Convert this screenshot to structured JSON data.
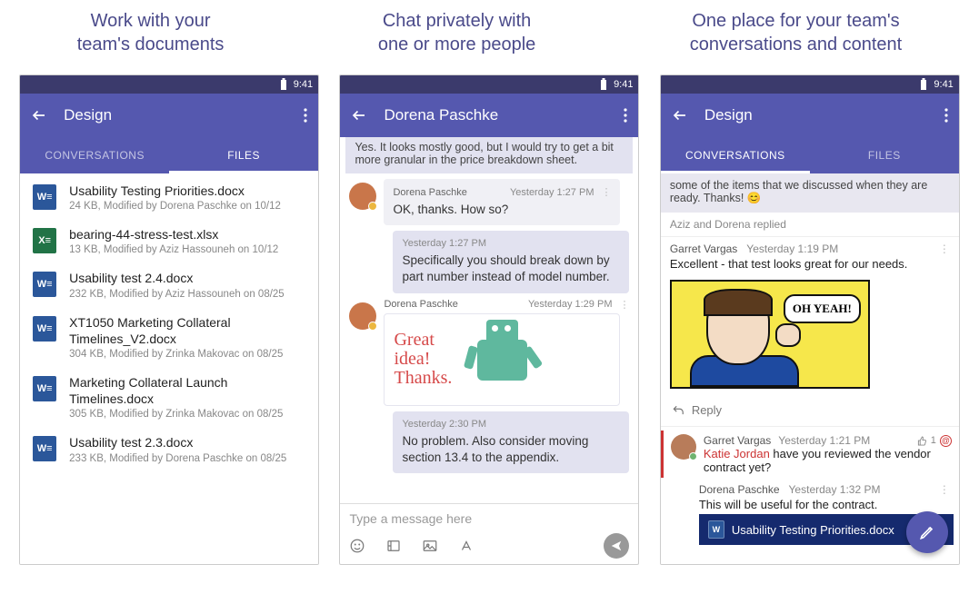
{
  "captions": [
    "Work with your\nteam's documents",
    "Chat privately with\none or more people",
    "One place for your team's\nconversations and content"
  ],
  "status": {
    "time": "9:41"
  },
  "panel1": {
    "title": "Design",
    "tabs": {
      "conversations": "CONVERSATIONS",
      "files": "FILES"
    },
    "files": [
      {
        "type": "word",
        "name": "Usability Testing Priorities.docx",
        "meta": "24 KB, Modified by Dorena Paschke on 10/12"
      },
      {
        "type": "excel",
        "name": "bearing-44-stress-test.xlsx",
        "meta": "13 KB, Modified by Aziz Hassouneh on 10/12"
      },
      {
        "type": "word",
        "name": "Usability test 2.4.docx",
        "meta": "232 KB, Modified by Aziz Hassouneh on 08/25"
      },
      {
        "type": "word",
        "name": "XT1050 Marketing Collateral Timelines_V2.docx",
        "meta": "304 KB, Modified by Zrinka Makovac on 08/25"
      },
      {
        "type": "word",
        "name": "Marketing Collateral Launch Timelines.docx",
        "meta": "305 KB, Modified by Zrinka Makovac on 08/25"
      },
      {
        "type": "word",
        "name": "Usability test 2.3.docx",
        "meta": "233 KB, Modified by Dorena Paschke on 08/25"
      }
    ]
  },
  "panel2": {
    "title": "Dorena Paschke",
    "cut_msg": "Yes. It looks mostly good, but I would try to get a bit more granular in the price breakdown sheet.",
    "messages": [
      {
        "side": "in",
        "name": "Dorena Paschke",
        "time": "Yesterday 1:27 PM",
        "text": "OK, thanks. How so?"
      },
      {
        "side": "out",
        "time": "Yesterday 1:27 PM",
        "text": "Specifically you should break down by part number instead of model number."
      },
      {
        "side": "in",
        "name": "Dorena Paschke",
        "time": "Yesterday 1:29 PM",
        "sticker": "Great idea! Thanks."
      },
      {
        "side": "out",
        "time": "Yesterday 2:30 PM",
        "text": "No problem. Also consider moving section 13.4 to the appendix."
      }
    ],
    "compose": {
      "placeholder": "Type a message here"
    }
  },
  "panel3": {
    "title": "Design",
    "tabs": {
      "conversations": "CONVERSATIONS",
      "files": "FILES"
    },
    "trail": "some of the items that we discussed when they are ready. Thanks! 😊",
    "replies_label": "Aziz and Dorena replied",
    "post1": {
      "name": "Garret Vargas",
      "time": "Yesterday 1:19 PM",
      "text": "Excellent - that test looks great for our needs."
    },
    "meme_text": "OH YEAH!",
    "reply_label": "Reply",
    "thread": {
      "name": "Garret Vargas",
      "time": "Yesterday 1:21 PM",
      "like": "1",
      "mention": "@",
      "mention_name": "Katie Jordan",
      "text": " have you reviewed the vendor contract yet?"
    },
    "thread2": {
      "name": "Dorena Paschke",
      "time": "Yesterday 1:32 PM",
      "text": "This will be useful for the contract."
    },
    "attachment": "Usability Testing Priorities.docx"
  }
}
